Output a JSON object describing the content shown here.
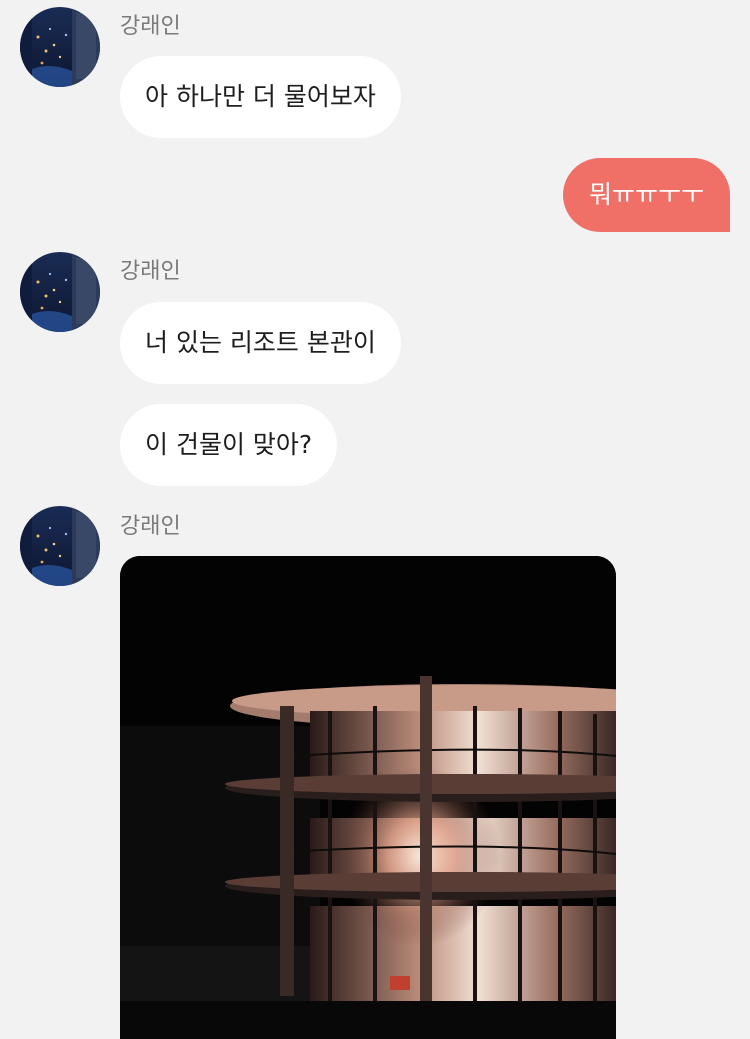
{
  "chat": {
    "sender_name": "강래인",
    "messages": [
      {
        "from": "other",
        "text": "아 하나만 더 물어보자"
      },
      {
        "from": "me",
        "text": "뭐ㅠㅠㅜㅜ"
      },
      {
        "from": "other",
        "text": "너 있는 리조트 본관이"
      },
      {
        "from": "other",
        "text": "이 건물이 맞아?"
      },
      {
        "from": "other",
        "type": "image",
        "subject": "night building photo"
      }
    ]
  },
  "colors": {
    "background": "#f2f2f2",
    "incoming_bubble": "#ffffff",
    "outgoing_bubble": "#f07068",
    "sender_name": "#7a7a7a"
  },
  "icons": {
    "avatar": "profile-photo-night-cityscape"
  }
}
